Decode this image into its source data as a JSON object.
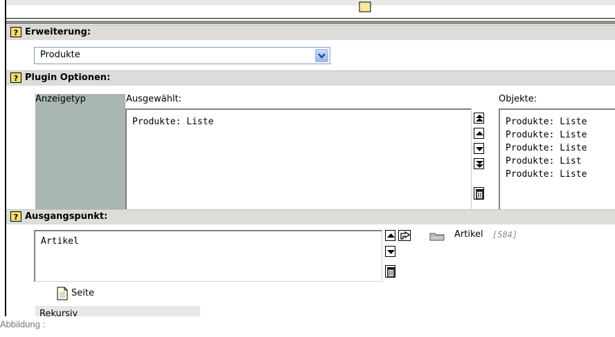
{
  "sections": {
    "erweiterung": {
      "title": "Erweiterung:"
    },
    "plugin": {
      "title": "Plugin Optionen:"
    },
    "ausgang": {
      "title": "Ausgangspunkt:"
    }
  },
  "erweiterung_select": {
    "value": "Produkte"
  },
  "plugin_options": {
    "anzeigetyp_label": "Anzeigetyp",
    "ausgewaehlt_label": "Ausgewählt:",
    "objekte_label": "Objekte:",
    "selected_items": [
      "Produkte: Liste"
    ],
    "objects": [
      "Produkte: Liste",
      "Produkte: Liste",
      "Produkte: Liste",
      "Produkte: List",
      "Produkte: Liste"
    ]
  },
  "ausgangspunkt": {
    "selected_items": [
      "Artikel"
    ],
    "record_label": "Artikel",
    "record_id": "[584]",
    "page_link": "Seite",
    "tab_cut": "Rekursiv"
  },
  "caption": "Abbildung :",
  "colors": {
    "header_bg": "#dcdcd8",
    "grey_cell": "#a8b7b1",
    "select_border": "#7f9db9"
  }
}
